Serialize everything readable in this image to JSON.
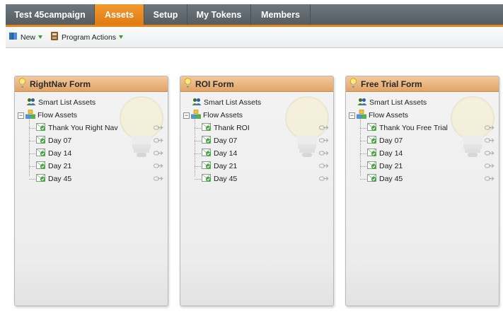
{
  "tabs": [
    {
      "label": "Test 45campaign",
      "active": false
    },
    {
      "label": "Assets",
      "active": true
    },
    {
      "label": "Setup",
      "active": false
    },
    {
      "label": "My Tokens",
      "active": false
    },
    {
      "label": "Members",
      "active": false
    }
  ],
  "toolbar": {
    "new_label": "New",
    "program_actions_label": "Program Actions"
  },
  "cards": [
    {
      "title": "RightNav Form",
      "smart_list_label": "Smart List Assets",
      "flow_label": "Flow Assets",
      "flow_items": [
        "Thank You Right Nav",
        "Day 07",
        "Day 14",
        "Day 21",
        "Day 45"
      ]
    },
    {
      "title": "ROI Form",
      "smart_list_label": "Smart List Assets",
      "flow_label": "Flow Assets",
      "flow_items": [
        "Thank ROI",
        "Day 07",
        "Day 14",
        "Day 21",
        "Day 45"
      ]
    },
    {
      "title": "Free Trial Form",
      "smart_list_label": "Smart List Assets",
      "flow_label": "Flow Assets",
      "flow_items": [
        "Thank You Free Trial",
        "Day 07",
        "Day 14",
        "Day 21",
        "Day 45"
      ]
    }
  ],
  "colors": {
    "tab_bg": "#5b646b",
    "tab_active": "#e07b12",
    "card_header": "#e2a466",
    "accent_green": "#3a9a2a"
  },
  "icons": {
    "new": "book-icon",
    "program_actions": "program-actions-icon",
    "smart_list": "people-icon",
    "flow": "flow-assets-icon",
    "email": "email-check-icon",
    "link": "link-arrow-icon",
    "bulb": "lightbulb-icon"
  }
}
